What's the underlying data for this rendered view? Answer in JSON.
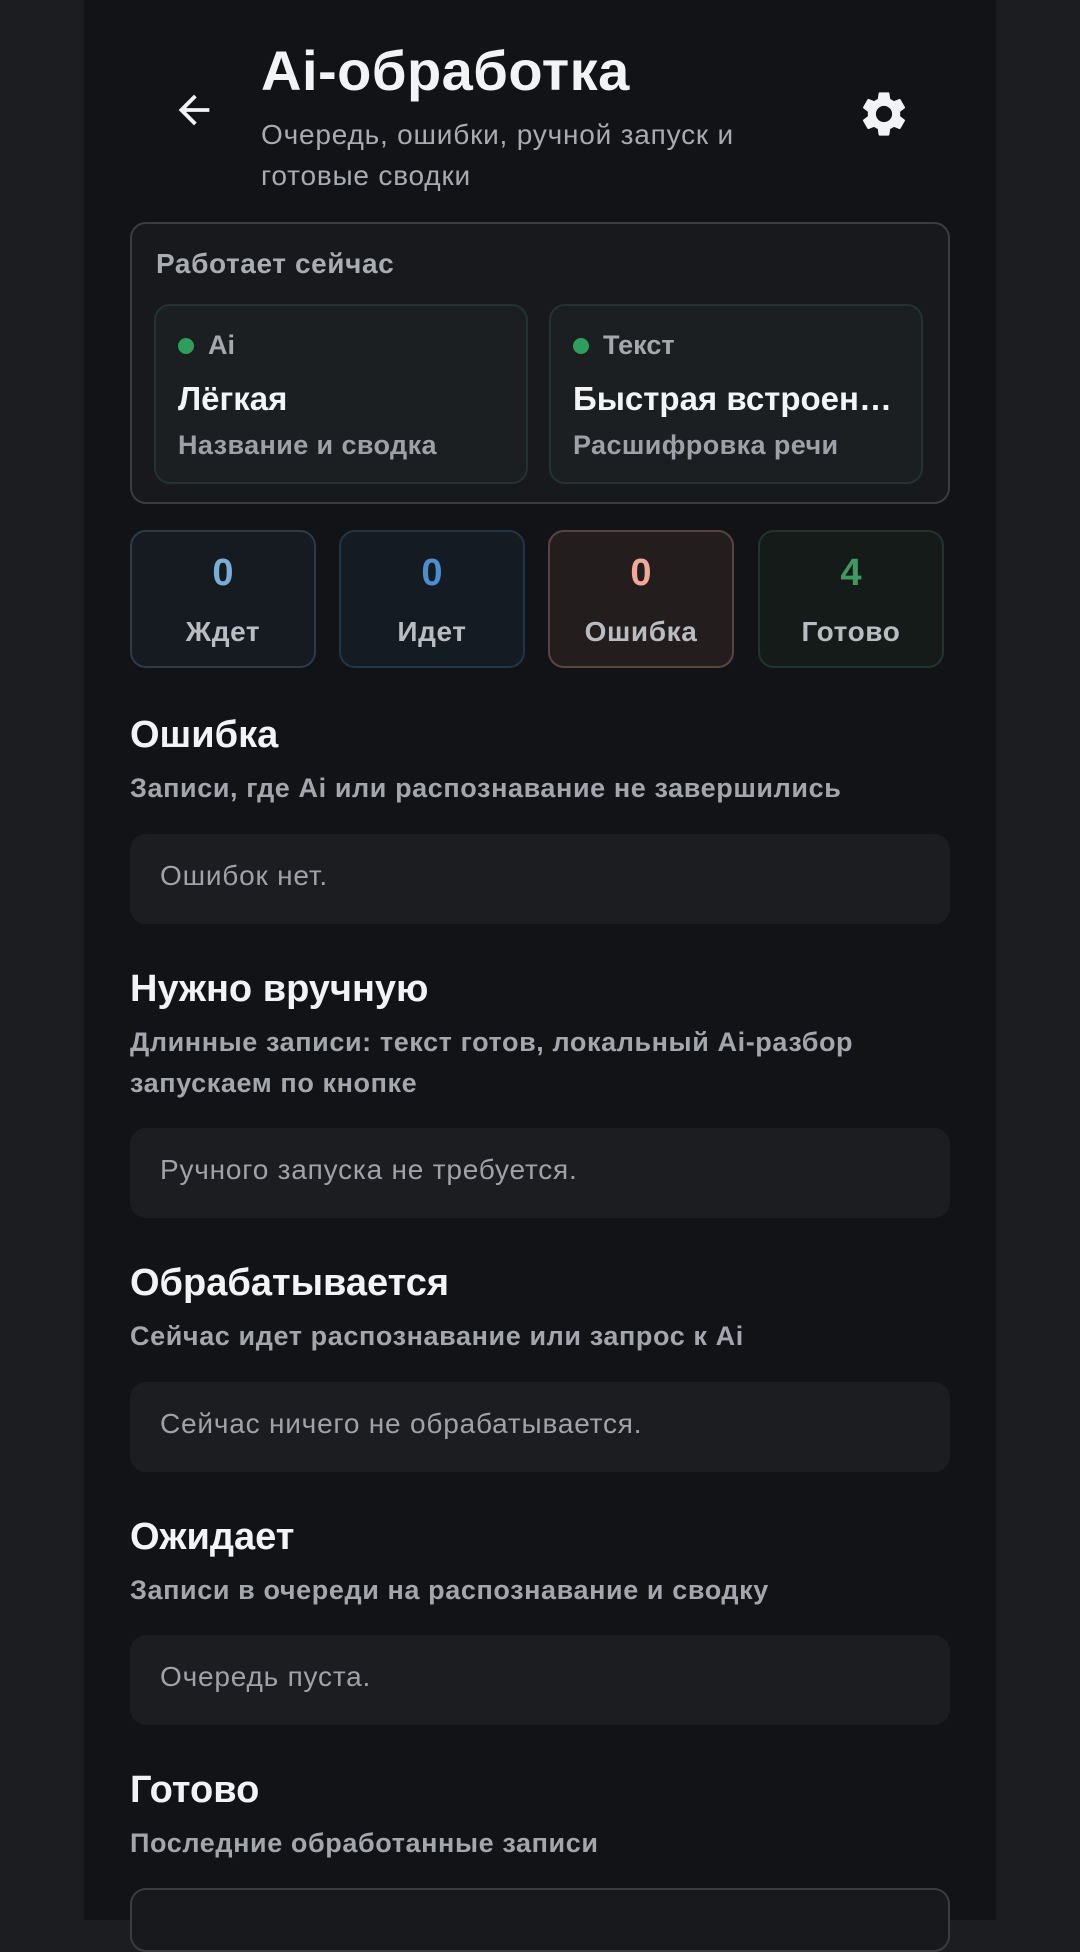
{
  "header": {
    "title": "Ai-обработка",
    "subtitle": "Очередь, ошибки, ручной запуск и готовые сводки",
    "back_icon": "arrow-left-icon",
    "settings_icon": "gear-icon"
  },
  "now_working": {
    "label": "Работает сейчас",
    "engines": [
      {
        "tag": "Ai",
        "name": "Лёгкая",
        "desc": "Название и сводка",
        "status_color": "#2f9e5d"
      },
      {
        "tag": "Текст",
        "name": "Быстрая встроенная",
        "desc": "Расшифровка речи",
        "status_color": "#2f9e5d"
      }
    ]
  },
  "stats": [
    {
      "value": "0",
      "label": "Ждет",
      "color": "#7aaed6"
    },
    {
      "value": "0",
      "label": "Идет",
      "color": "#4a8fc9"
    },
    {
      "value": "0",
      "label": "Ошибка",
      "color": "#f2a99a"
    },
    {
      "value": "4",
      "label": "Готово",
      "color": "#3f9a62"
    }
  ],
  "sections": [
    {
      "title": "Ошибка",
      "desc": "Записи, где Ai или распознавание не завершились",
      "empty": "Ошибок нет."
    },
    {
      "title": "Нужно вручную",
      "desc": "Длинные записи: текст готов, локальный Ai-разбор запускаем по кнопке",
      "empty": "Ручного запуска не требуется."
    },
    {
      "title": "Обрабатывается",
      "desc": "Сейчас идет распознавание или запрос к Ai",
      "empty": "Сейчас ничего не обрабатывается."
    },
    {
      "title": "Ожидает",
      "desc": "Записи в очереди на распознавание и сводку",
      "empty": "Очередь пуста."
    },
    {
      "title": "Готово",
      "desc": "Последние обработанные записи"
    }
  ]
}
